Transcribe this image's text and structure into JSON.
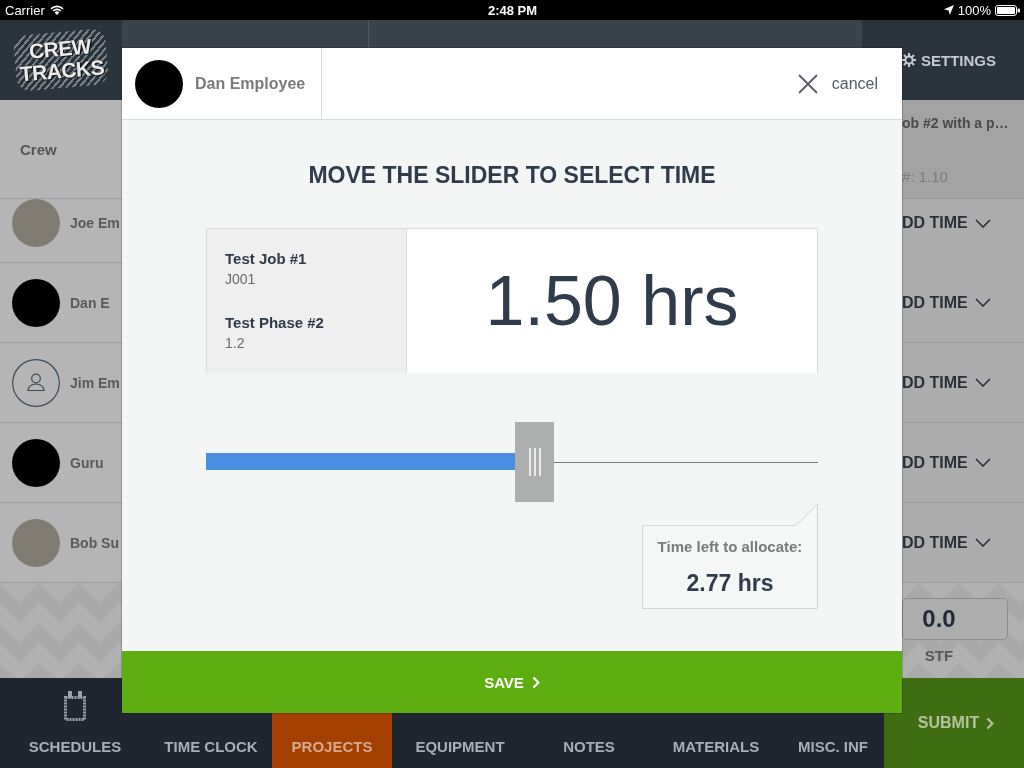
{
  "status_bar": {
    "carrier": "Carrier",
    "time": "2:48 PM",
    "battery": "100%"
  },
  "header": {
    "logo": [
      "CREW",
      "TRACKS"
    ],
    "settings": "SETTINGS"
  },
  "crew": {
    "heading": "Crew",
    "members": [
      {
        "name": "Joe Em",
        "kind": "photo"
      },
      {
        "name": "Dan E",
        "kind": "blank"
      },
      {
        "name": "Jim Em",
        "kind": "default"
      },
      {
        "name": "Guru",
        "kind": "blank"
      },
      {
        "name": "Bob Su",
        "kind": "photo"
      }
    ]
  },
  "job_column": {
    "title": "ob #2 with a p…",
    "phase": "#: 1.10",
    "rows": [
      {
        "action": "DD TIME"
      },
      {
        "action": "DD TIME"
      },
      {
        "action": "DD TIME"
      },
      {
        "action": "DD TIME"
      },
      {
        "action": "DD TIME"
      }
    ],
    "total": "0.0",
    "total_label": "STF"
  },
  "nav": {
    "tabs": [
      {
        "label": "SCHEDULES",
        "selected": false
      },
      {
        "label": "TIME CLOCK",
        "selected": false
      },
      {
        "label": "PROJECTS",
        "selected": true
      },
      {
        "label": "EQUIPMENT",
        "selected": false
      },
      {
        "label": "NOTES",
        "selected": false
      },
      {
        "label": "MATERIALS",
        "selected": false
      },
      {
        "label": "MISC. INF",
        "selected": false
      }
    ],
    "submit": "SUBMIT"
  },
  "modal": {
    "employee": "Dan Employee",
    "cancel": "cancel",
    "title": "MOVE THE SLIDER TO SELECT TIME",
    "job": {
      "name": "Test Job #1",
      "code": "J001"
    },
    "phase": {
      "name": "Test Phase #2",
      "code": "1.2"
    },
    "hours": "1.50 hrs",
    "slider": {
      "level": 0.54
    },
    "time_left": {
      "label": "Time left to allocate:",
      "value": "2.77 hrs"
    },
    "save": "SAVE"
  }
}
